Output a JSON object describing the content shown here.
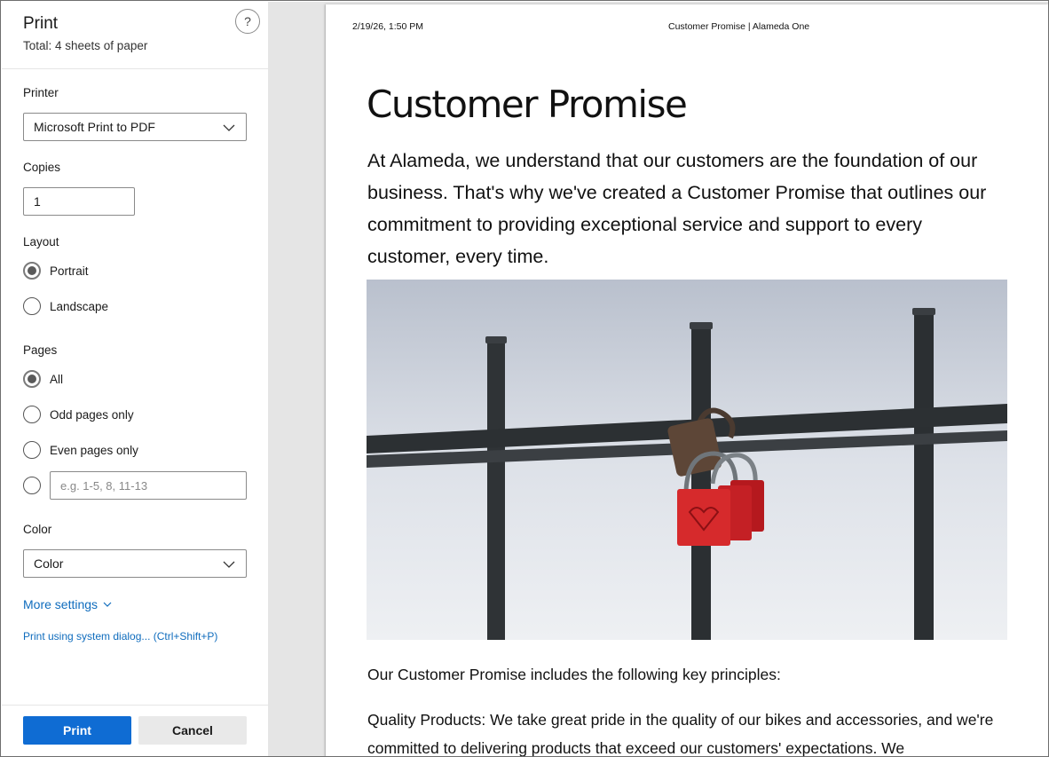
{
  "panel": {
    "title": "Print",
    "subtitle": "Total: 4 sheets of paper",
    "help_label": "?",
    "printer": {
      "label": "Printer",
      "value": "Microsoft Print to PDF"
    },
    "copies": {
      "label": "Copies",
      "value": "1"
    },
    "layout": {
      "label": "Layout",
      "options": [
        "Portrait",
        "Landscape"
      ],
      "selected": "Portrait"
    },
    "pages": {
      "label": "Pages",
      "options": [
        "All",
        "Odd pages only",
        "Even pages only"
      ],
      "selected": "All",
      "range_placeholder": "e.g. 1-5, 8, 11-13"
    },
    "color": {
      "label": "Color",
      "value": "Color"
    },
    "more_settings": "More settings",
    "system_dialog": "Print using system dialog... (Ctrl+Shift+P)",
    "print_button": "Print",
    "cancel_button": "Cancel"
  },
  "preview": {
    "header_date": "2/19/26, 1:50 PM",
    "header_title": "Customer Promise | Alameda One",
    "title": "Customer Promise",
    "intro": "At Alameda, we understand that our customers are the foundation of our business. That's why we've created a Customer Promise that outlines our commitment to providing exceptional service and support to every customer, every time.",
    "para1": "Our Customer Promise includes the following key principles:",
    "para2": "Quality Products: We take great pride in the quality of our bikes and accessories, and we're committed to delivering products that exceed our customers' expectations. We",
    "image_description": "red padlocks on iron fence"
  },
  "colors": {
    "accent": "#0f6cd3",
    "link": "#0f6cbd"
  }
}
